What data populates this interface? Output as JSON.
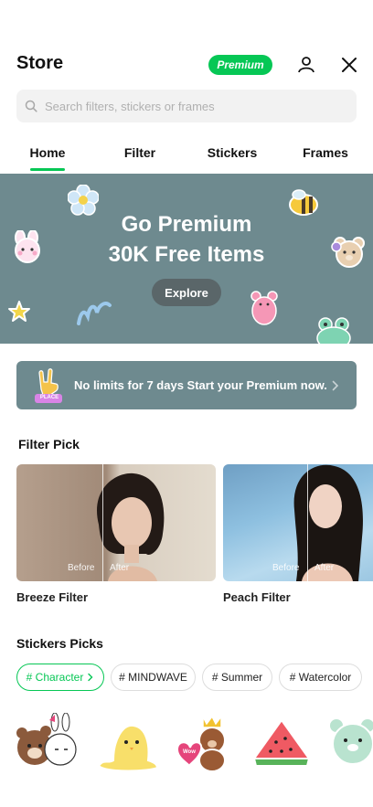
{
  "header": {
    "title": "Store",
    "premium_label": "Premium",
    "profile_icon": "person-icon",
    "close_icon": "close-icon"
  },
  "search": {
    "placeholder": "Search filters, stickers or frames",
    "value": "",
    "icon": "search-icon"
  },
  "tabs": [
    {
      "label": "Home",
      "active": true
    },
    {
      "label": "Filter",
      "active": false
    },
    {
      "label": "Stickers",
      "active": false
    },
    {
      "label": "Frames",
      "active": false
    }
  ],
  "banner": {
    "line1": "Go Premium",
    "line2": "30K Free Items",
    "button_label": "Explore"
  },
  "promo": {
    "text": "No limits for 7 days Start your Premium now.",
    "badge_text": "PLACE"
  },
  "filter_pick": {
    "title": "Filter Pick",
    "cards": [
      {
        "name": "Breeze Filter",
        "before": "Before",
        "after": "After"
      },
      {
        "name": "Peach Filter",
        "before": "Before",
        "after": "After"
      }
    ]
  },
  "stickers_picks": {
    "title": "Stickers Picks",
    "chips": [
      {
        "label": "# Character",
        "active": true
      },
      {
        "label": "# MINDWAVE",
        "active": false
      },
      {
        "label": "# Summer",
        "active": false
      },
      {
        "label": "# Watercolor",
        "active": false
      }
    ],
    "stickers": [
      "brown-and-cony",
      "melting-chick",
      "crowned-bear-with-heart",
      "watermelon-slice",
      "mint-bear"
    ],
    "heart_bubble_text": "Wow"
  },
  "colors": {
    "accent": "#06c755",
    "banner_bg": "#6e8a8f"
  }
}
